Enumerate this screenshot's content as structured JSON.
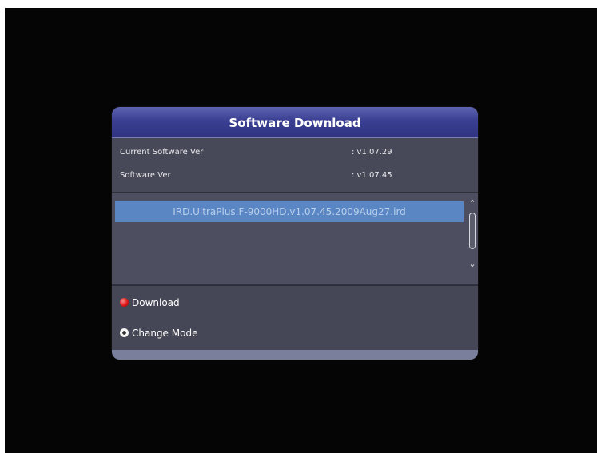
{
  "dialog": {
    "title": "Software Download"
  },
  "info": {
    "rows": [
      {
        "label": "Current Software Ver",
        "value": ": v1.07.29"
      },
      {
        "label": "Software Ver",
        "value": ": v1.07.45"
      }
    ]
  },
  "file_list": {
    "items": [
      "IRD.UltraPlus.F-9000HD.v1.07.45.2009Aug27.ird"
    ],
    "selected_index": 0
  },
  "actions": {
    "download_label": "Download",
    "change_mode_label": "Change Mode",
    "download_icon": "red-button-icon",
    "change_mode_icon": "white-button-icon"
  },
  "colors": {
    "title_bar": "#3a3f92",
    "selection": "#5a86c4",
    "panel": "#4c4d5c"
  }
}
